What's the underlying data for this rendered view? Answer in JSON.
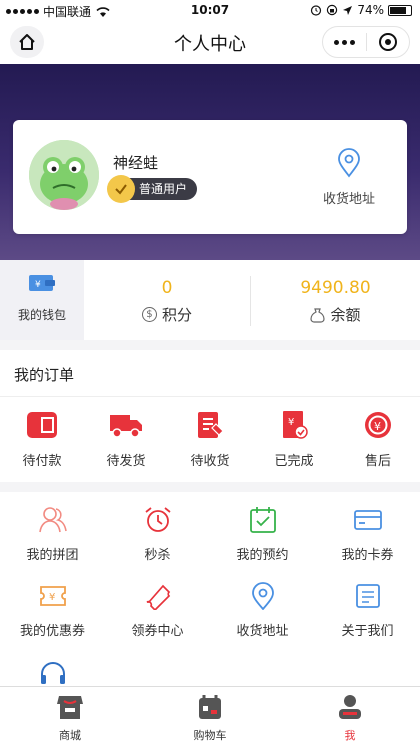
{
  "status_bar": {
    "carrier": "中国联通",
    "time": "10:07",
    "battery": "74%"
  },
  "nav": {
    "title": "个人中心"
  },
  "profile": {
    "name": "神经蛙",
    "level": "普通用户",
    "address_label": "收货地址"
  },
  "wallet": {
    "label": "我的钱包",
    "points_value": "0",
    "points_label": "积分",
    "balance_value": "9490.80",
    "balance_label": "余额"
  },
  "orders": {
    "title": "我的订单",
    "items": [
      {
        "label": "待付款",
        "icon": "wallet-icon"
      },
      {
        "label": "待发货",
        "icon": "truck-icon"
      },
      {
        "label": "待收货",
        "icon": "document-icon"
      },
      {
        "label": "已完成",
        "icon": "receipt-check-icon"
      },
      {
        "label": "售后",
        "icon": "yen-circle-icon"
      }
    ]
  },
  "services": {
    "items": [
      {
        "label": "我的拼团",
        "icon": "group-icon"
      },
      {
        "label": "秒杀",
        "icon": "alarm-clock-icon"
      },
      {
        "label": "我的预约",
        "icon": "calendar-check-icon"
      },
      {
        "label": "我的卡券",
        "icon": "card-icon"
      },
      {
        "label": "我的优惠券",
        "icon": "coupon-icon"
      },
      {
        "label": "领券中心",
        "icon": "ticket-icon"
      },
      {
        "label": "收货地址",
        "icon": "location-icon"
      },
      {
        "label": "关于我们",
        "icon": "about-icon"
      }
    ]
  },
  "tabbar": {
    "items": [
      {
        "label": "商城",
        "icon": "store-icon"
      },
      {
        "label": "购物车",
        "icon": "cart-icon"
      },
      {
        "label": "我",
        "icon": "profile-icon"
      }
    ],
    "active": "我"
  },
  "colors": {
    "accent": "#e7333b",
    "balance": "#f0b41c",
    "hero_top": "#231a52",
    "service_icon": "#4a90e2"
  }
}
